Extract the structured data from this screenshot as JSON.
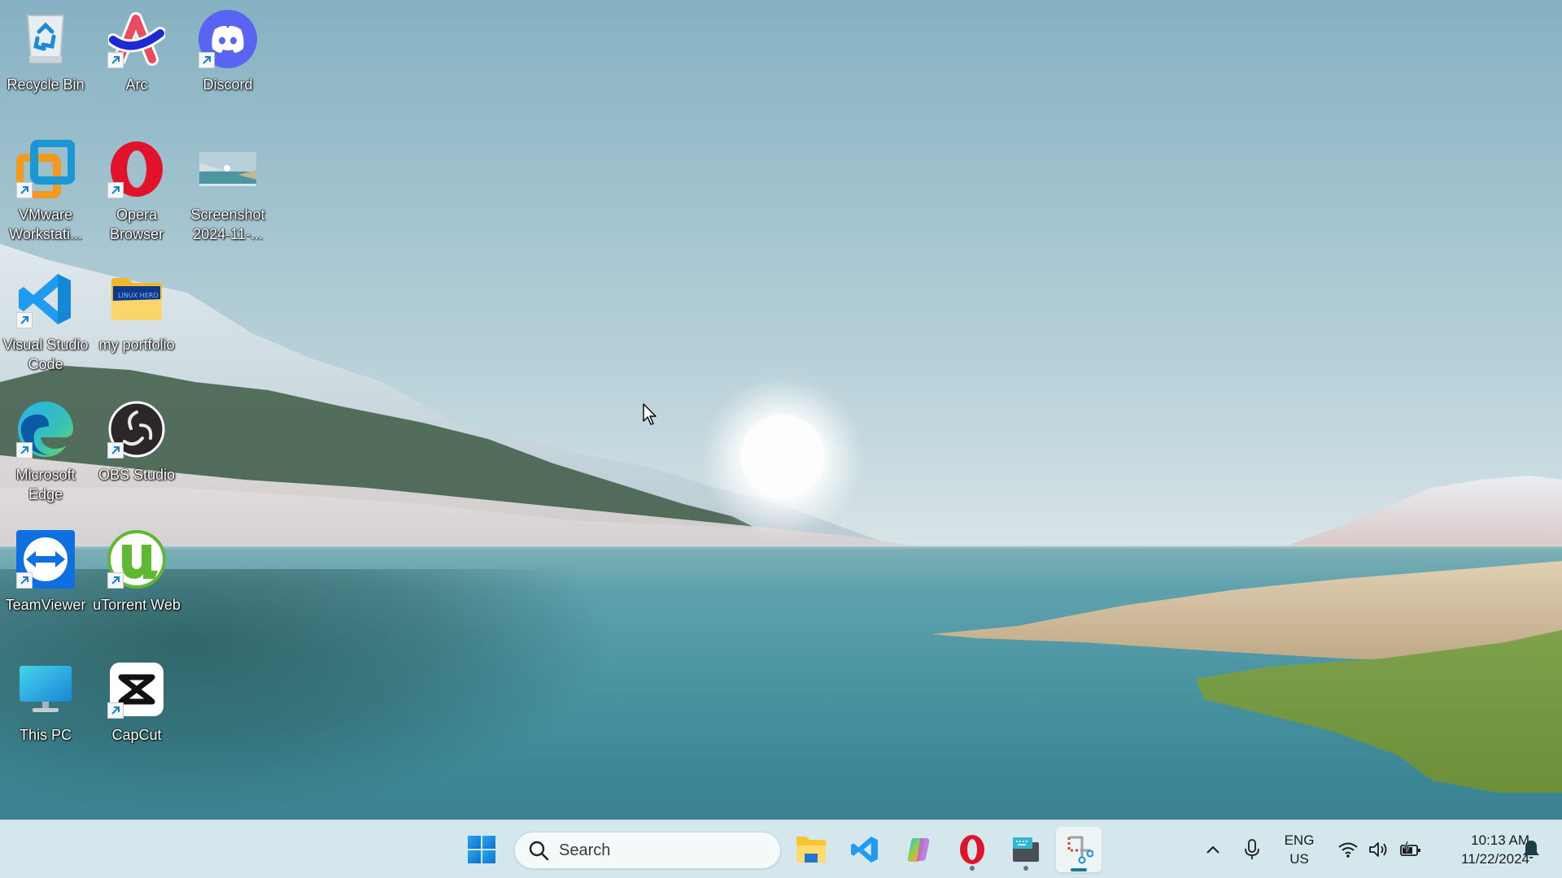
{
  "desktop": {
    "icons": [
      {
        "label": "Recycle Bin",
        "icon": "recycle-bin-icon",
        "shortcut": false
      },
      {
        "label": "Arc",
        "icon": "arc-browser-icon",
        "shortcut": true
      },
      {
        "label": "Discord",
        "icon": "discord-icon",
        "shortcut": true
      },
      {
        "label": "VMware Workstati...",
        "icon": "vmware-icon",
        "shortcut": true
      },
      {
        "label": "Opera Browser",
        "icon": "opera-icon",
        "shortcut": true
      },
      {
        "label": "Screenshot 2024-11-...",
        "icon": "image-thumbnail-icon",
        "shortcut": false
      },
      {
        "label": "Visual Studio Code",
        "icon": "vscode-icon",
        "shortcut": true
      },
      {
        "label": "my portfolio",
        "icon": "folder-icon",
        "shortcut": false
      },
      {
        "label": "Microsoft Edge",
        "icon": "edge-icon",
        "shortcut": true
      },
      {
        "label": "OBS Studio",
        "icon": "obs-icon",
        "shortcut": true
      },
      {
        "label": "TeamViewer",
        "icon": "teamviewer-icon",
        "shortcut": true
      },
      {
        "label": "uTorrent Web",
        "icon": "utorrent-icon",
        "shortcut": true
      },
      {
        "label": "This PC",
        "icon": "this-pc-icon",
        "shortcut": false
      },
      {
        "label": "CapCut",
        "icon": "capcut-icon",
        "shortcut": true
      }
    ],
    "folder_thumbnail_text": "LINUX HERO"
  },
  "taskbar": {
    "start": {
      "icon": "windows-start-icon"
    },
    "search": {
      "placeholder": "Search"
    },
    "pinned": [
      {
        "name": "File Explorer",
        "icon": "file-explorer-icon",
        "state": "idle"
      },
      {
        "name": "Visual Studio Code",
        "icon": "vscode-icon",
        "state": "idle"
      },
      {
        "name": "Copilot",
        "icon": "copilot-icon",
        "state": "idle"
      },
      {
        "name": "Opera",
        "icon": "opera-icon",
        "state": "running"
      },
      {
        "name": "Touch Keyboard / Terminal",
        "icon": "keyboard-window-icon",
        "state": "running"
      },
      {
        "name": "Snipping Tool",
        "icon": "snipping-tool-icon",
        "state": "active"
      }
    ],
    "tray": {
      "language_line1": "ENG",
      "language_line2": "US",
      "time": "10:13 AM",
      "date": "11/22/2024"
    }
  },
  "colors": {
    "taskbar_bg": "#d4e7ec",
    "accent": "#1e7d8c"
  }
}
